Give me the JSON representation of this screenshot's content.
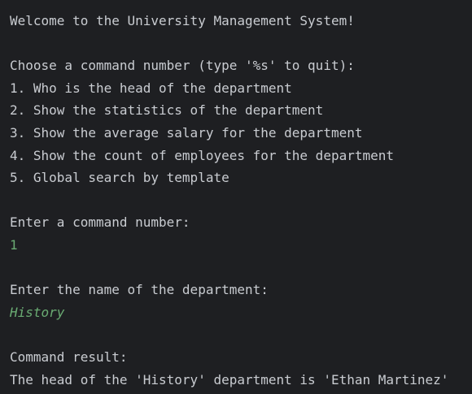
{
  "console": {
    "welcome": "Welcome to the University Management System!",
    "choose_prompt": "Choose a command number (type '%s' to quit):",
    "commands": [
      "1. Who is the head of the department",
      "2. Show the statistics of the department",
      "3. Show the average salary for the department",
      "4. Show the count of employees for the department",
      "5. Global search by template"
    ],
    "enter_command_prompt": "Enter a command number:",
    "command_input": "1",
    "enter_department_prompt": "Enter the name of the department:",
    "department_input": "History",
    "result_label": "Command result:",
    "result_text": "The head of the 'History' department is 'Ethan Martinez'"
  },
  "colors": {
    "background": "#1e1f22",
    "text": "#c9ccd1",
    "user_input": "#6aab73"
  }
}
